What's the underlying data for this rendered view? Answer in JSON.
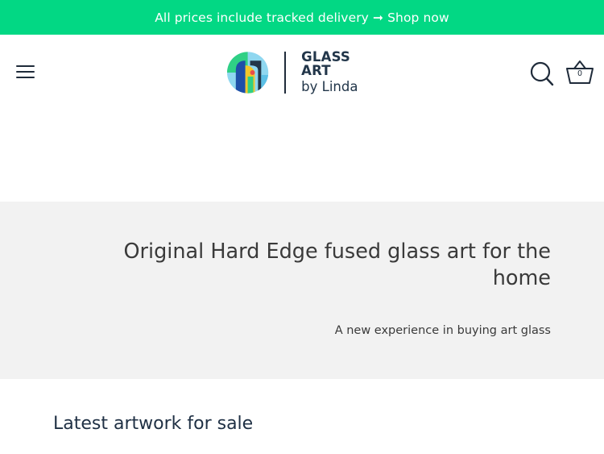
{
  "announcement": {
    "text": "All prices include tracked delivery ➞ Shop now"
  },
  "header": {
    "menu_icon": "hamburger-menu-icon",
    "logo": {
      "line1": "GLASS ART",
      "line2": "by Linda",
      "mark_icon": "glass-art-logo-mark"
    },
    "search_icon": "search-icon",
    "cart_icon": "basket-icon",
    "cart_count": "0"
  },
  "hero": {
    "title": "Original Hard Edge fused glass art for the home",
    "subtitle": "A new experience in buying art glass"
  },
  "latest": {
    "title": "Latest artwork for sale"
  },
  "colors": {
    "announcement_bg": "#02d884",
    "hero_bg": "#f2f2f2",
    "heading": "#1f3044",
    "text": "#3a3a3a"
  }
}
